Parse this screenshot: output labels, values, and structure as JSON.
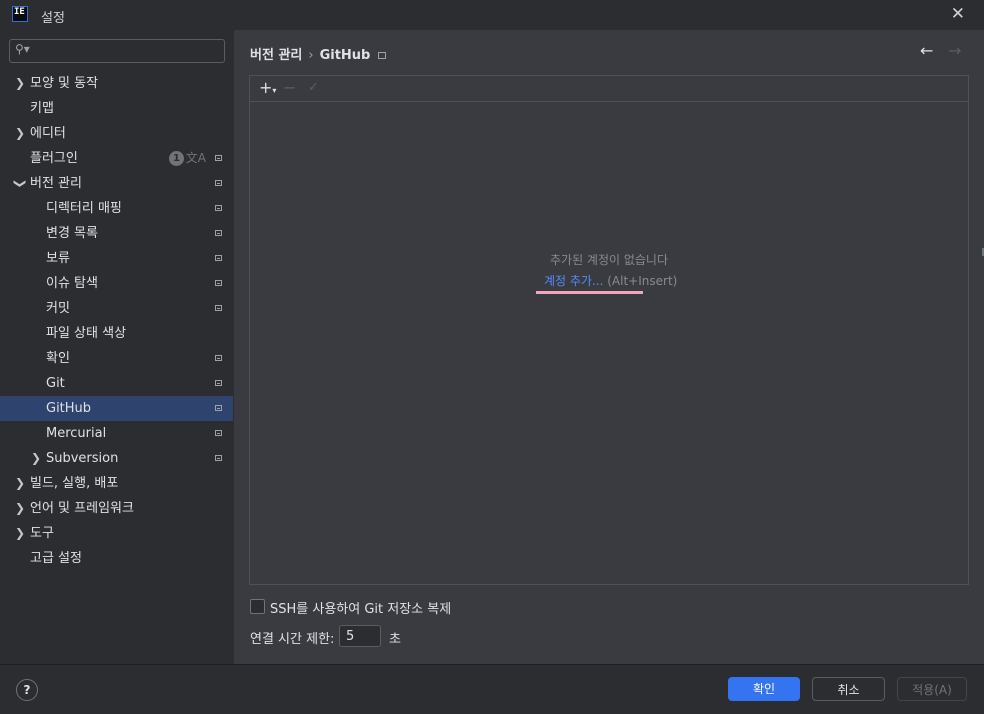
{
  "window": {
    "title": "설정",
    "app_icon_text": "IE"
  },
  "sidebar": {
    "search": {
      "placeholder": ""
    },
    "items": [
      {
        "label": "모양 및 동작",
        "expandable": true
      },
      {
        "label": "키맵"
      },
      {
        "label": "에디터",
        "expandable": true
      },
      {
        "label": "플러그인",
        "badge": "1"
      },
      {
        "label": "버전 관리",
        "expanded": true
      },
      {
        "label": "디렉터리 매핑"
      },
      {
        "label": "변경 목록"
      },
      {
        "label": "보류"
      },
      {
        "label": "이슈 탐색"
      },
      {
        "label": "커밋"
      },
      {
        "label": "파일 상태 색상"
      },
      {
        "label": "확인"
      },
      {
        "label": "Git"
      },
      {
        "label": "GitHub",
        "selected": true
      },
      {
        "label": "Mercurial"
      },
      {
        "label": "Subversion",
        "expandable": true
      },
      {
        "label": "빌드, 실행, 배포",
        "expandable": true
      },
      {
        "label": "언어 및 프레임워크",
        "expandable": true
      },
      {
        "label": "도구",
        "expandable": true
      },
      {
        "label": "고급 설정"
      }
    ]
  },
  "breadcrumb": {
    "parent": "버전 관리",
    "separator": "›",
    "current": "GitHub"
  },
  "panel": {
    "empty_text": "추가된 계정이 없습니다",
    "add_link": "계정 추가...",
    "add_shortcut": "(Alt+Insert)"
  },
  "options": {
    "ssh_clone_label": "SSH를 사용하여 Git 저장소 복제",
    "ssh_clone_checked": false,
    "timeout_label": "연결 시간 제한:",
    "timeout_value": "5",
    "timeout_unit": "초"
  },
  "footer": {
    "help": "?",
    "ok": "확인",
    "cancel": "취소",
    "apply": "적용(A)"
  },
  "colors": {
    "accent": "#3574f0",
    "selection": "#2e436e",
    "link": "#548af7"
  }
}
